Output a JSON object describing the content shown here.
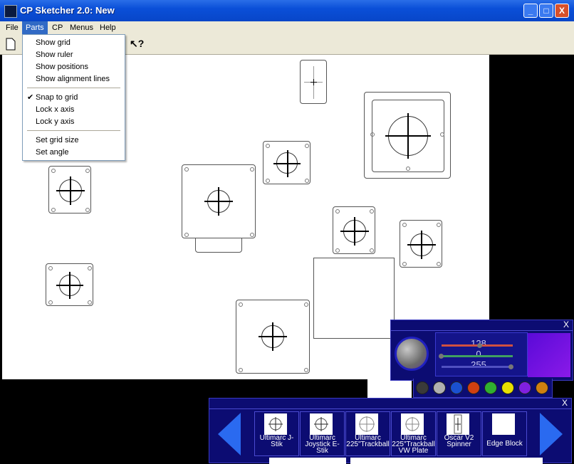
{
  "window": {
    "title": "CP Sketcher 2.0: New",
    "controls": {
      "minimize": "_",
      "maximize": "□",
      "close": "X"
    }
  },
  "menubar": {
    "items": [
      "File",
      "Parts",
      "CP",
      "Menus",
      "Help"
    ]
  },
  "dropdown": {
    "items": [
      {
        "label": "Show grid",
        "checked": false
      },
      {
        "label": "Show ruler",
        "checked": false
      },
      {
        "label": "Show positions",
        "checked": false
      },
      {
        "label": "Show alignment lines",
        "checked": false
      },
      {
        "label": "Snap to grid",
        "checked": true
      },
      {
        "label": "Lock x axis",
        "checked": false
      },
      {
        "label": "Lock y axis",
        "checked": false
      },
      {
        "label": "Set grid size",
        "checked": false
      },
      {
        "label": "Set angle",
        "checked": false
      }
    ],
    "check_mark": "✔"
  },
  "toolbar": {
    "help_cursor": "↖?"
  },
  "color_panel": {
    "values": [
      "128",
      "0",
      "255"
    ],
    "slider_colors": [
      "#d05040",
      "#40a060",
      "#5050c0"
    ],
    "preview_color": "#6a10e0",
    "swatches": [
      "#3a3a3a",
      "#b0b0b0",
      "#1a50d0",
      "#d04010",
      "#30b030",
      "#e8e000",
      "#8020e0",
      "#d08010"
    ],
    "close": "X"
  },
  "parts_panel": {
    "close": "X",
    "parts": [
      {
        "label": "Ultimarc J-Stik"
      },
      {
        "label": "Ultimarc Joystick E-Stik"
      },
      {
        "label": "Ultimarc 225\"Trackball"
      },
      {
        "label": "Ultimarc 225\"Trackball VW Plate"
      },
      {
        "label": "Oscar V2 Spinner"
      },
      {
        "label": "Edge Block"
      }
    ]
  }
}
